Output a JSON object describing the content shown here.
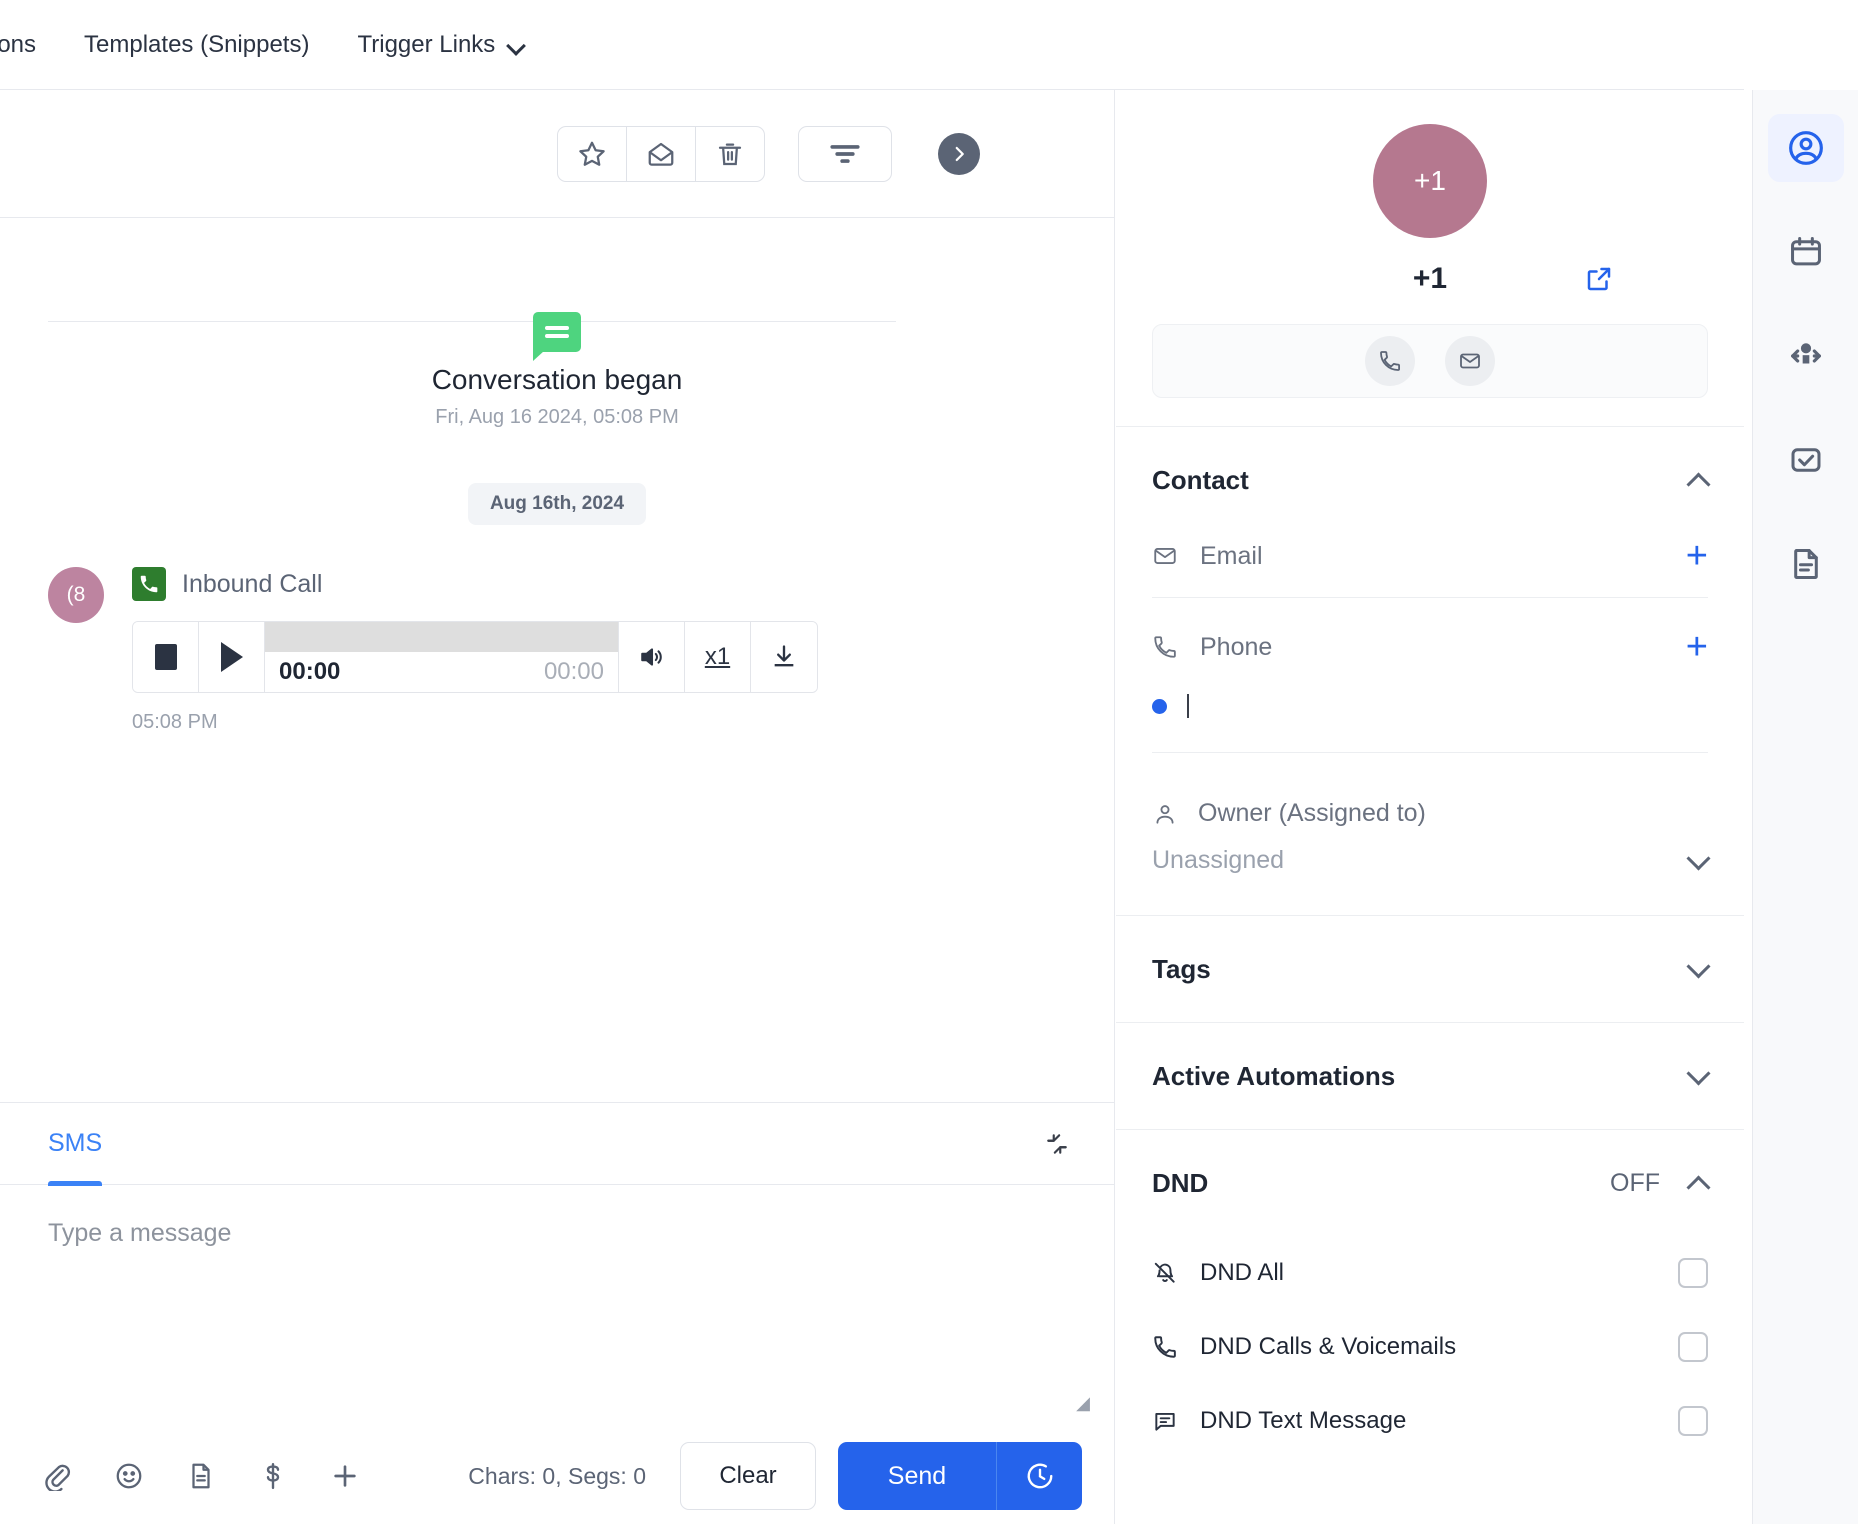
{
  "topnav": {
    "items": [
      {
        "label": "ions",
        "has_chevron": false
      },
      {
        "label": "Templates (Snippets)",
        "has_chevron": false
      },
      {
        "label": "Trigger Links",
        "has_chevron": true
      }
    ]
  },
  "toolbar": {
    "star_icon": "star-icon",
    "mark_unread_icon": "open-envelope-icon",
    "delete_icon": "trash-icon",
    "filter_icon": "filter-icon",
    "expand_icon": "chevron-right-circle-icon"
  },
  "thread": {
    "conversation_began_title": "Conversation began",
    "conversation_began_date": "Fri, Aug 16 2024, 05:08 PM",
    "date_chip": "Aug 16th, 2024",
    "message": {
      "avatar_initials": "(8",
      "type_label": "Inbound Call",
      "type_icon": "phone-incoming-icon",
      "timestamp": "05:08 PM",
      "player": {
        "stop_icon": "stop-icon",
        "play_icon": "play-icon",
        "current_time": "00:00",
        "duration": "00:00",
        "volume_icon": "volume-icon",
        "speed_label": "x1",
        "download_icon": "download-icon",
        "progress_percent": 0
      }
    }
  },
  "composer": {
    "active_tab": "SMS",
    "collapse_icon": "collapse-diagonal-icon",
    "placeholder": "Type a message",
    "message_value": "",
    "icons": [
      {
        "name": "attachment-icon"
      },
      {
        "name": "emoji-icon"
      },
      {
        "name": "template-icon"
      },
      {
        "name": "payment-icon"
      },
      {
        "name": "add-icon"
      }
    ],
    "char_counter": "Chars: 0, Segs: 0",
    "clear_label": "Clear",
    "send_label": "Send",
    "schedule_icon": "clock-schedule-icon"
  },
  "contact_panel": {
    "avatar_initials": "+1",
    "name": "+1",
    "open_link_icon": "external-link-icon",
    "quick_actions": [
      {
        "name": "call-icon"
      },
      {
        "name": "email-icon"
      }
    ],
    "sections": {
      "contact": {
        "title": "Contact",
        "expanded": true,
        "fields": [
          {
            "label": "Email",
            "icon": "envelope-icon",
            "add": "+"
          },
          {
            "label": "Phone",
            "icon": "phone-icon",
            "add": "+"
          }
        ],
        "phone_entry_value": "",
        "owner_label": "Owner (Assigned to)",
        "owner_icon": "user-icon",
        "owner_value": "Unassigned"
      },
      "tags": {
        "title": "Tags",
        "expanded": false
      },
      "active_automations": {
        "title": "Active Automations",
        "expanded": false
      },
      "dnd": {
        "title": "DND",
        "status": "OFF",
        "expanded": true,
        "options": [
          {
            "label": "DND All",
            "icon": "bell-off-icon",
            "checked": false
          },
          {
            "label": "DND Calls & Voicemails",
            "icon": "phone-icon",
            "checked": false
          },
          {
            "label": "DND Text Message",
            "icon": "message-icon",
            "checked": false
          }
        ]
      }
    }
  },
  "rail": {
    "items": [
      {
        "name": "contact-icon",
        "active": true
      },
      {
        "name": "calendar-icon",
        "active": false
      },
      {
        "name": "opportunities-icon",
        "active": false
      },
      {
        "name": "tasks-icon",
        "active": false
      },
      {
        "name": "documents-icon",
        "active": false
      }
    ]
  },
  "colors": {
    "accent_blue": "#2563eb",
    "avatar_mauve": "#b5788f",
    "green_bubble": "#4ed47f",
    "call_green": "#2e7d2e"
  }
}
